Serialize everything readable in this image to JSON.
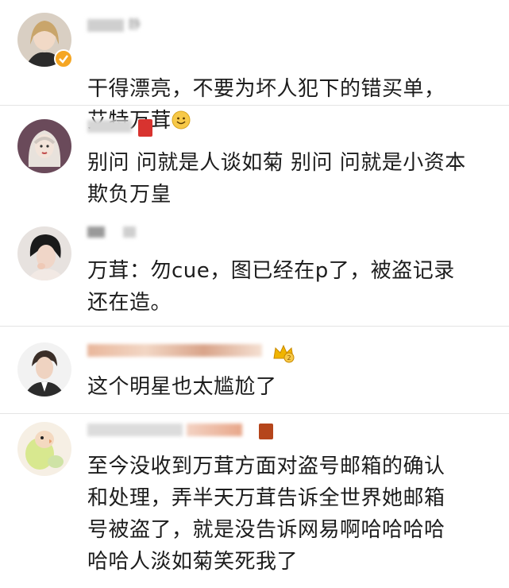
{
  "comments": [
    {
      "username": "静",
      "text": "干得漂亮，不要为坏人犯下的错买单，\n艾特万茸",
      "emoji": "smiley-emoji",
      "verified": true
    },
    {
      "username": "",
      "text": "别问 问就是人谈如菊 别问 问就是小资本\n欺负万皇"
    },
    {
      "username": "",
      "text": "万茸：勿cue，图已经在p了，被盗记录\n还在造。"
    },
    {
      "username": "",
      "text": "这个明星也太尴尬了",
      "badge": "crown-badge-icon"
    },
    {
      "username": "",
      "text": "至今没收到万茸方面对盗号邮箱的确认\n和处理，弄半天万茸告诉全世界她邮箱\n号被盗了，就是没告诉网易啊哈哈哈哈\n哈哈人淡如菊笑死我了"
    }
  ],
  "colors": {
    "text": "#1c1c1c",
    "divider": "#e4e4e4",
    "verified": "#f5a623",
    "crown": "#f0b400"
  }
}
